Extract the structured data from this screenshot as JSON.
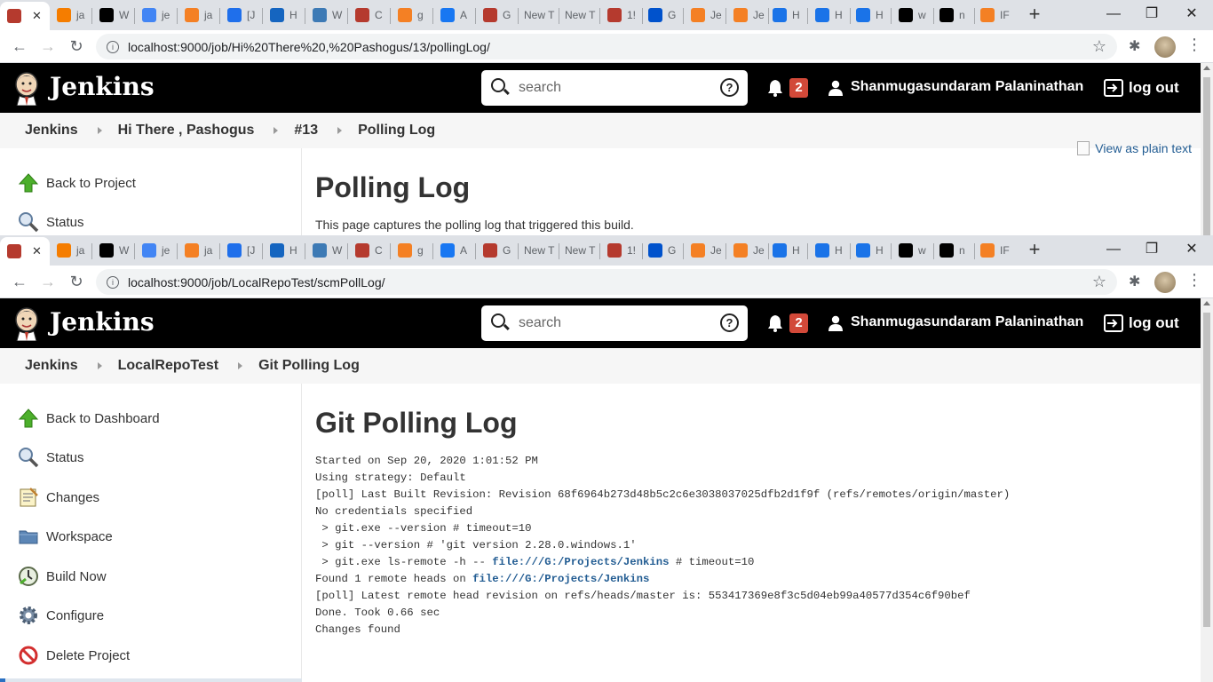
{
  "browser_tabs": [
    {
      "label": "",
      "icon": "jenkins-icon",
      "color": "#b53a2e",
      "active": true
    },
    {
      "label": "ja",
      "icon": "blogger-icon",
      "color": "#f57d00"
    },
    {
      "label": "W",
      "icon": "github-icon",
      "color": "#000000"
    },
    {
      "label": "je",
      "icon": "google-icon",
      "color": "#4285f4"
    },
    {
      "label": "ja",
      "icon": "stackoverflow-icon",
      "color": "#f48024"
    },
    {
      "label": "[J",
      "icon": "diamond-icon",
      "color": "#1f6feb"
    },
    {
      "label": "H",
      "icon": "eh-icon",
      "color": "#1565c0"
    },
    {
      "label": "W",
      "icon": "globe-icon",
      "color": "#3d7ab5"
    },
    {
      "label": "C",
      "icon": "jenkins-icon",
      "color": "#b53a2e"
    },
    {
      "label": "g",
      "icon": "stackoverflow-icon",
      "color": "#f48024"
    },
    {
      "label": "A",
      "icon": "facebook-icon",
      "color": "#1877f2"
    },
    {
      "label": "G",
      "icon": "jenkins-icon",
      "color": "#b53a2e"
    },
    {
      "label": "New T",
      "icon": "",
      "color": "#dee1e6"
    },
    {
      "label": "New T",
      "icon": "",
      "color": "#dee1e6"
    },
    {
      "label": "1!",
      "icon": "jenkins-icon",
      "color": "#b53a2e"
    },
    {
      "label": "G",
      "icon": "atlassian-icon",
      "color": "#0052cc"
    },
    {
      "label": "Je",
      "icon": "stackoverflow-icon",
      "color": "#f48024"
    },
    {
      "label": "Je",
      "icon": "stackoverflow-icon",
      "color": "#f48024"
    },
    {
      "label": "H",
      "icon": "h-icon",
      "color": "#1a73e8"
    },
    {
      "label": "H",
      "icon": "h-icon",
      "color": "#1a73e8"
    },
    {
      "label": "H",
      "icon": "h-icon",
      "color": "#1a73e8"
    },
    {
      "label": "w",
      "icon": "github-icon",
      "color": "#000000"
    },
    {
      "label": "n",
      "icon": "n-icon",
      "color": "#000000"
    },
    {
      "label": "IF",
      "icon": "stackoverflow-icon",
      "color": "#f48024"
    }
  ],
  "new_tab_symbol": "+",
  "window_controls": {
    "minimize": "—",
    "maximize": "❐",
    "close": "✕"
  },
  "tab_close": "✕",
  "window1": {
    "url": "localhost:9000/job/Hi%20There%20,%20Pashogus/13/pollingLog/",
    "breadcrumbs": [
      "Jenkins",
      "Hi There , Pashogus",
      "#13",
      "Polling Log"
    ],
    "sidebar": [
      {
        "label": "Back to Project",
        "icon": "up-arrow-icon"
      },
      {
        "label": "Status",
        "icon": "magnifier-icon"
      }
    ],
    "view_plain": "View as plain text",
    "page_title": "Polling Log",
    "description": "This page captures the polling log that triggered this build."
  },
  "window2": {
    "url": "localhost:9000/job/LocalRepoTest/scmPollLog/",
    "breadcrumbs": [
      "Jenkins",
      "LocalRepoTest",
      "Git Polling Log"
    ],
    "sidebar": [
      {
        "label": "Back to Dashboard",
        "icon": "up-arrow-icon"
      },
      {
        "label": "Status",
        "icon": "magnifier-icon"
      },
      {
        "label": "Changes",
        "icon": "notepad-icon"
      },
      {
        "label": "Workspace",
        "icon": "folder-icon"
      },
      {
        "label": "Build Now",
        "icon": "clock-icon"
      },
      {
        "label": "Configure",
        "icon": "gear-icon"
      },
      {
        "label": "Delete Project",
        "icon": "no-entry-icon"
      }
    ],
    "page_title": "Git Polling Log",
    "log": {
      "l1": "Started on Sep 20, 2020 1:01:52 PM",
      "l2": "Using strategy: Default",
      "l3": "[poll] Last Built Revision: Revision 68f6964b273d48b5c2c6e3038037025dfb2d1f9f (refs/remotes/origin/master)",
      "l4": "No credentials specified",
      "l5": " > git.exe --version # timeout=10",
      "l6": " > git --version # 'git version 2.28.0.windows.1'",
      "l7a": " > git.exe ls-remote -h -- ",
      "l7link": "file:///G:/Projects/Jenkins",
      "l7b": " # timeout=10",
      "l8a": "Found 1 remote heads on ",
      "l8link": "file:///G:/Projects/Jenkins",
      "l9": "[poll] Latest remote head revision on refs/heads/master is: 553417369e8f3c5d04eb99a40577d354c6f90bef",
      "l10": "Done. Took 0.66 sec",
      "l11": "Changes found"
    }
  },
  "jenkins": {
    "title": "Jenkins",
    "search_placeholder": "search",
    "help": "?",
    "notification_count": "2",
    "user": "Shanmugasundaram Palaninathan",
    "logout": "log out"
  },
  "colors": {
    "header_bg": "#000000",
    "badge": "#d24939",
    "link": "#235d93",
    "tabstrip": "#dee1e6"
  }
}
